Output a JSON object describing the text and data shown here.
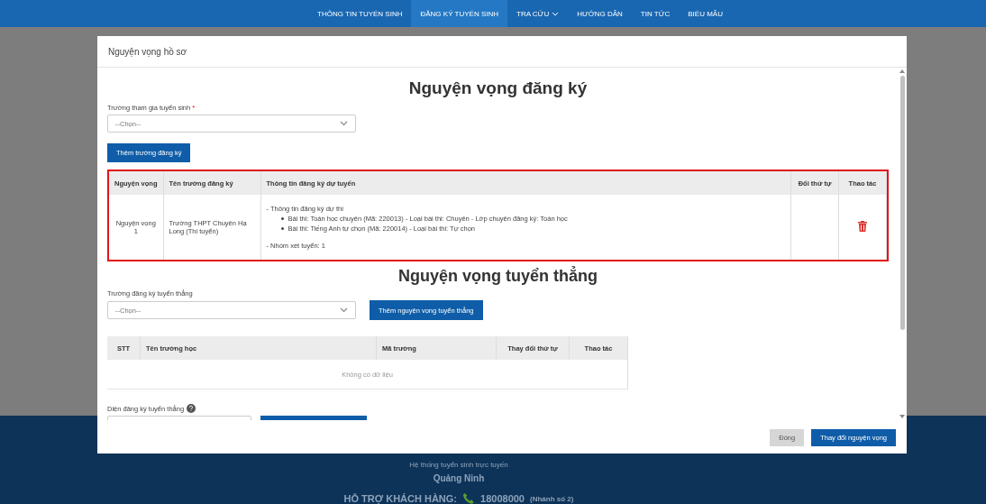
{
  "nav": {
    "items": [
      {
        "label": "THÔNG TIN TUYỂN SINH",
        "selected": false,
        "dropdown": false
      },
      {
        "label": "ĐĂNG KÝ TUYỂN SINH",
        "selected": true,
        "dropdown": false
      },
      {
        "label": "TRA CỨU",
        "selected": false,
        "dropdown": true
      },
      {
        "label": "HƯỚNG DẪN",
        "selected": false,
        "dropdown": false
      },
      {
        "label": "TIN TỨC",
        "selected": false,
        "dropdown": false
      },
      {
        "label": "BIỂU MẪU",
        "selected": false,
        "dropdown": false
      }
    ]
  },
  "footer": {
    "tagline": "Hệ thống tuyển sinh trực tuyến",
    "province": "Quảng Ninh",
    "support_label": "HỖ TRỢ KHÁCH HÀNG:",
    "phone": "18008000",
    "extension": "(Nhánh số 2)"
  },
  "modal": {
    "title": "Nguyện vọng hồ sơ",
    "registration": {
      "heading": "Nguyện vọng đăng ký",
      "school_label": "Trường tham gia tuyển sinh",
      "required_mark": "*",
      "school_placeholder": "--Chọn--",
      "add_button": "Thêm trường đăng ký",
      "highlighted": true,
      "columns": [
        "Nguyện vọng",
        "Tên trường đăng ký",
        "Thông tin đăng ký dự tuyển",
        "Đổi thứ tự",
        "Thao tác"
      ],
      "rows": [
        {
          "preference": "Nguyện vọng 1",
          "school": "Trường THPT Chuyên Hạ Long (Thi tuyển)",
          "info_title": "- Thông tin đăng ký dự thi",
          "exams": [
            "Bài thi: Toán học chuyên (Mã: 220013) - Loại bài thi: Chuyên - Lớp chuyên đăng ký: Toán học",
            "Bài thi: Tiếng Anh tự chọn (Mã: 220014) - Loại bài thi: Tự chọn"
          ],
          "group": "- Nhóm xét tuyển: 1"
        }
      ]
    },
    "direct": {
      "heading": "Nguyện vọng tuyển thẳng",
      "school_label": "Trường đăng ký tuyển thẳng",
      "school_placeholder": "--Chọn--",
      "add_button": "Thêm nguyện vọng tuyển thẳng",
      "columns": [
        "STT",
        "Tên trường học",
        "Mã trường",
        "Thay đổi thứ tự",
        "Thao tác"
      ],
      "empty_text": "Không có dữ liệu",
      "category_label": "Diện đăng ký tuyển thẳng"
    },
    "buttons": [
      {
        "label": "Đóng",
        "kind": "secondary"
      },
      {
        "label": "Thay đổi nguyện vọng",
        "kind": "primary"
      }
    ]
  }
}
